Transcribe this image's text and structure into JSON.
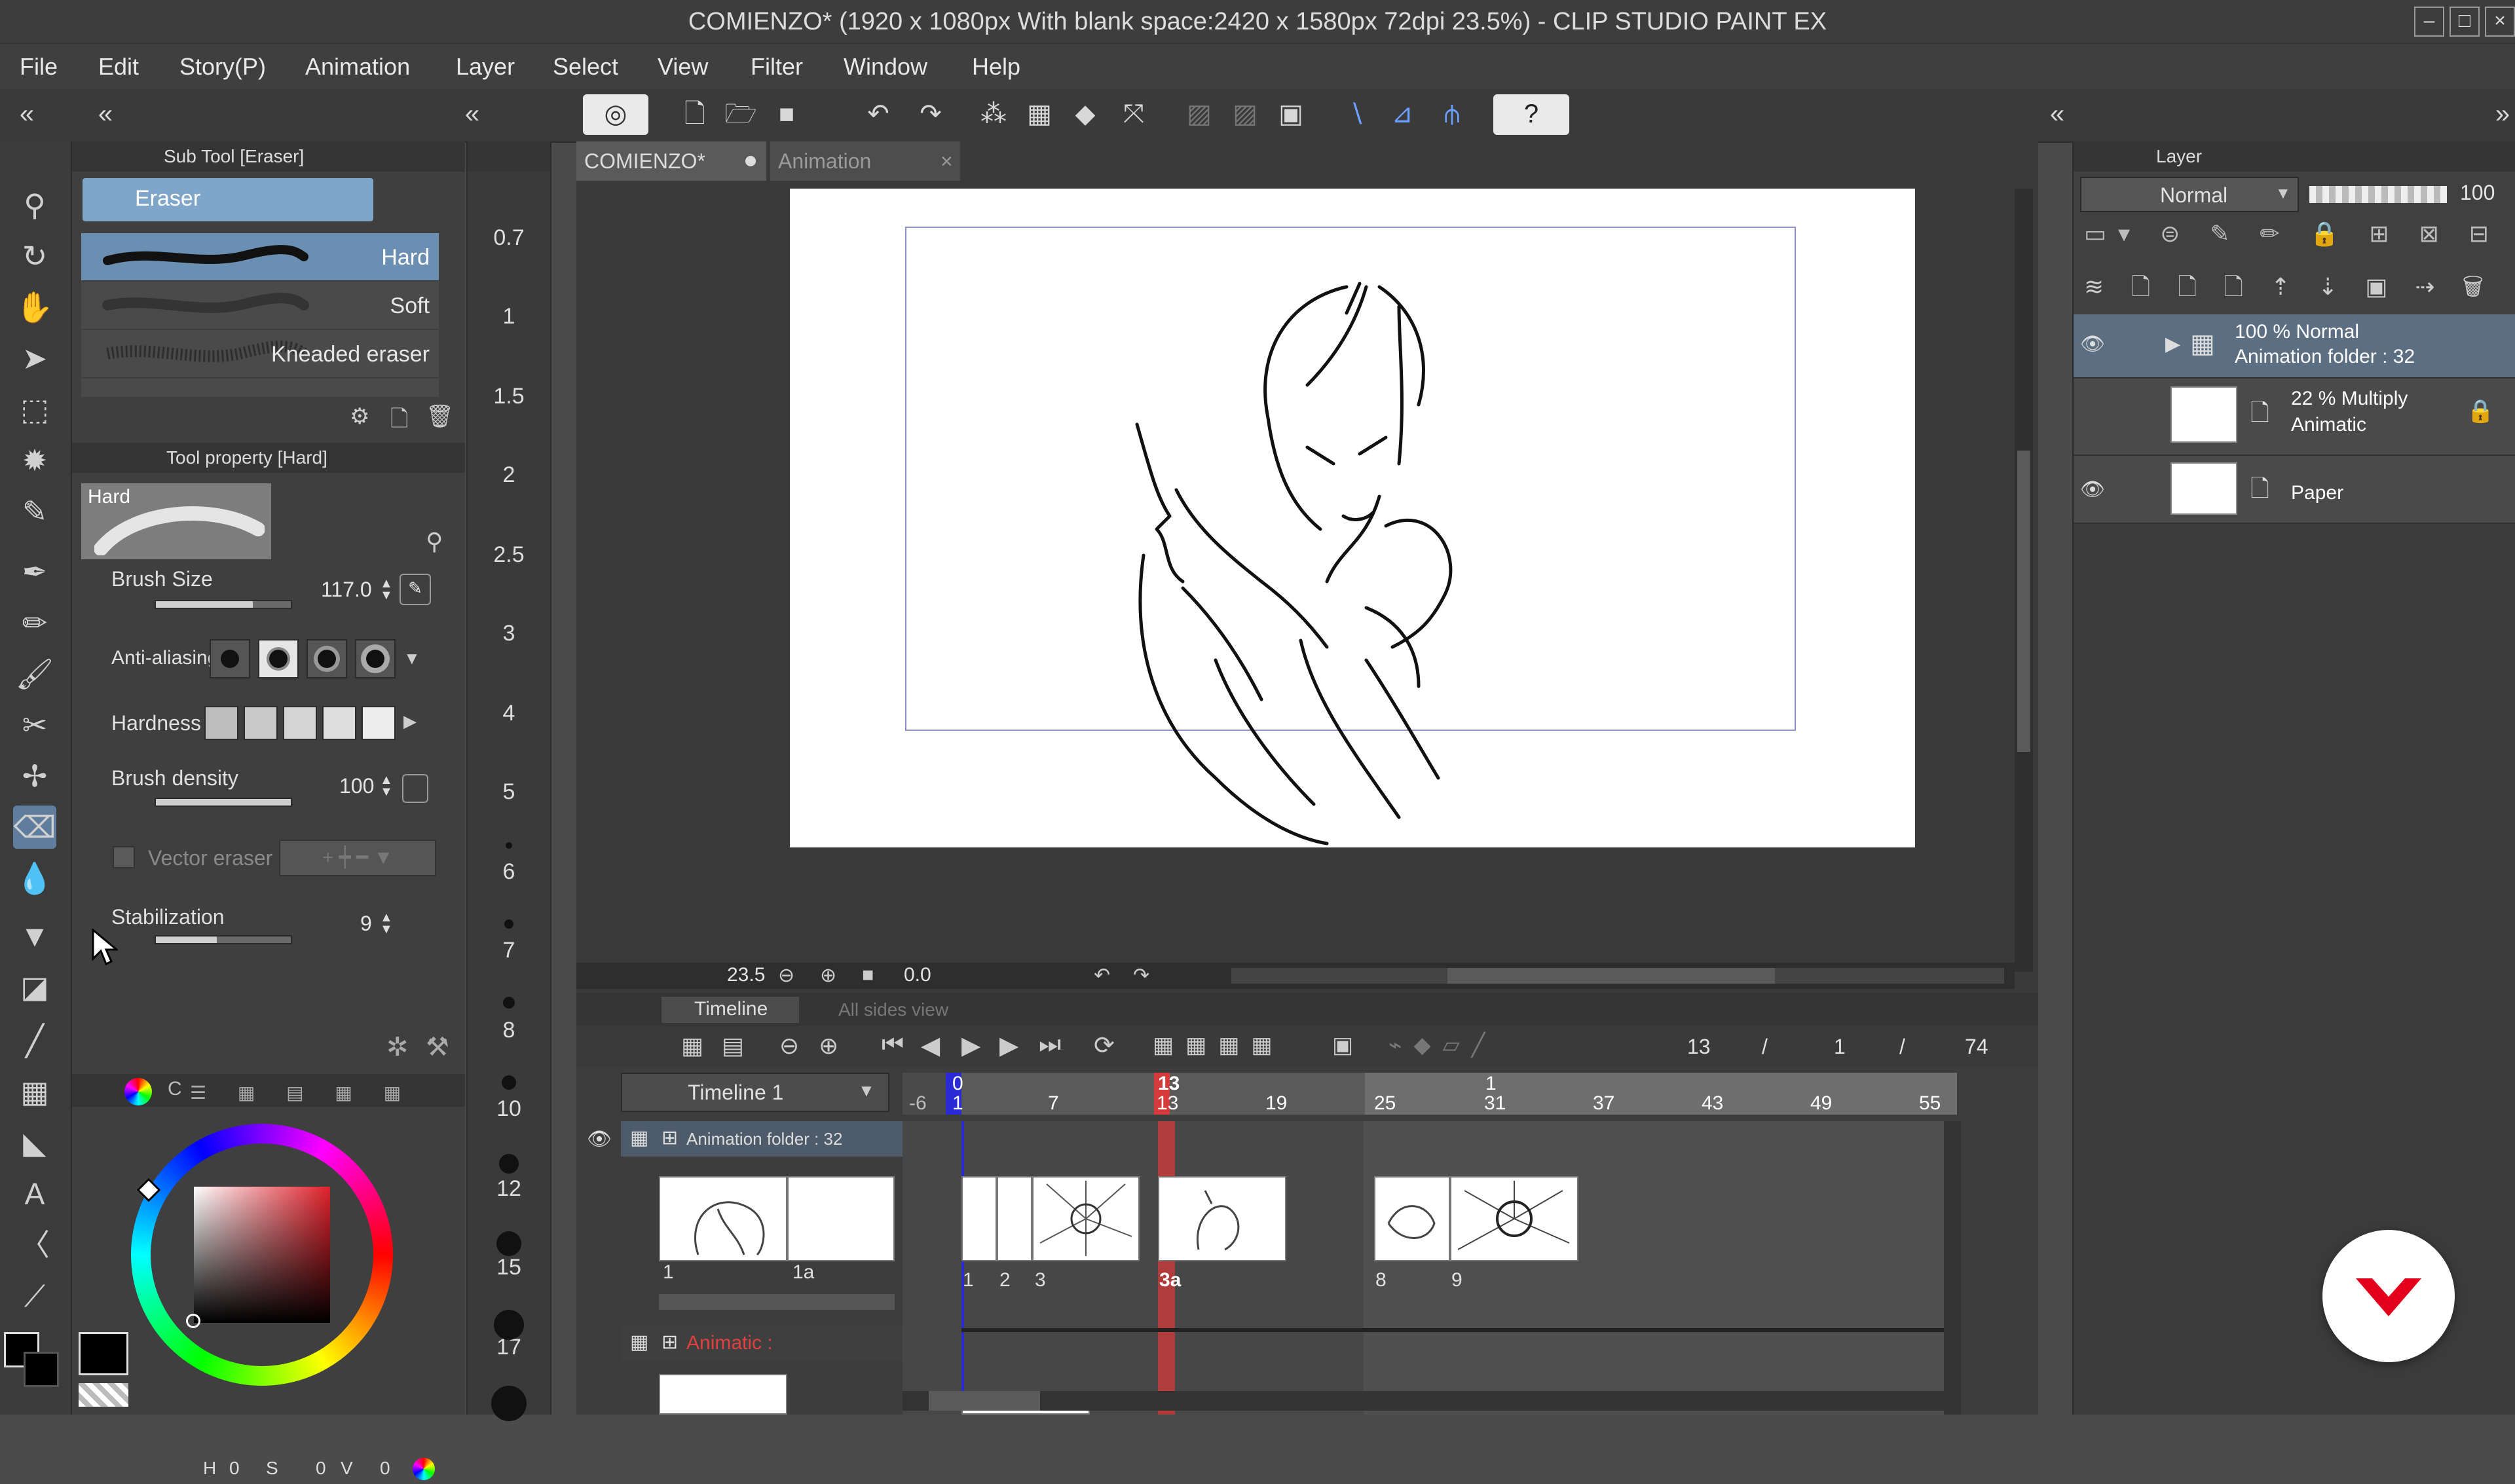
{
  "window": {
    "title": "COMIENZO* (1920 x 1080px With blank space:2420 x 1580px 72dpi 23.5%) - CLIP STUDIO PAINT EX"
  },
  "menu": [
    "File",
    "Edit",
    "Story(P)",
    "Animation",
    "Layer",
    "Select",
    "View",
    "Filter",
    "Window",
    "Help"
  ],
  "subtool_panel": {
    "title": "Sub Tool [Eraser]",
    "group": "Eraser",
    "brushes": [
      "Hard",
      "Soft",
      "Kneaded eraser"
    ]
  },
  "tool_property": {
    "title": "Tool property [Hard]",
    "preset": "Hard",
    "brush_size_label": "Brush Size",
    "brush_size_value": "117.0",
    "antialias_label": "Anti-aliasing",
    "hardness_label": "Hardness",
    "density_label": "Brush density",
    "density_value": "100",
    "vector_eraser_label": "Vector eraser",
    "stabilization_label": "Stabilization",
    "stabilization_value": "9"
  },
  "color_panel": {
    "h_label": "H",
    "h_value": "0",
    "s_label": "S",
    "s_value": "0",
    "v_label": "V",
    "v_value": "0",
    "tab_label": "C"
  },
  "brush_ruler": [
    "0.7",
    "1",
    "1.5",
    "2",
    "2.5",
    "3",
    "4",
    "5",
    "6",
    "7",
    "8",
    "10",
    "12",
    "15",
    "17"
  ],
  "canvas": {
    "tabs": [
      "COMIENZO*",
      "Animation"
    ],
    "zoom": "23.5",
    "angle": "0.0"
  },
  "timeline": {
    "tab_label": "Timeline",
    "tab2_label": "All sides view",
    "name": "Timeline 1",
    "current_frame": "13",
    "sep1": "/",
    "sep2": "/",
    "playback": "1",
    "total_frames": "74",
    "ruler_numbers": [
      "-6",
      "1",
      "7",
      "13",
      "19",
      "25",
      "31",
      "37",
      "43",
      "49",
      "55"
    ],
    "ruler_top_numbers": [
      "0",
      "13",
      "1"
    ],
    "folder_track_label": "Animation folder : 32",
    "animatic_track_label": "Animatic :",
    "folder_cels": [
      "1",
      "1a"
    ],
    "cel_labels": [
      "1",
      "2",
      "3",
      "3a",
      "8",
      "9"
    ]
  },
  "layer_panel": {
    "title": "Layer",
    "blend_mode": "Normal",
    "opacity": "100",
    "layers": [
      {
        "line1": "100 % Normal",
        "line2": "Animation folder : 32"
      },
      {
        "line1": "22 % Multiply",
        "line2": "Animatic"
      },
      {
        "line1": "Paper",
        "line2": ""
      }
    ]
  },
  "colors": {
    "accent": "#5f7d9d",
    "playhead": "#d63a3a",
    "cursor_blue": "#2b2bd6",
    "brand": "#e3001b"
  }
}
